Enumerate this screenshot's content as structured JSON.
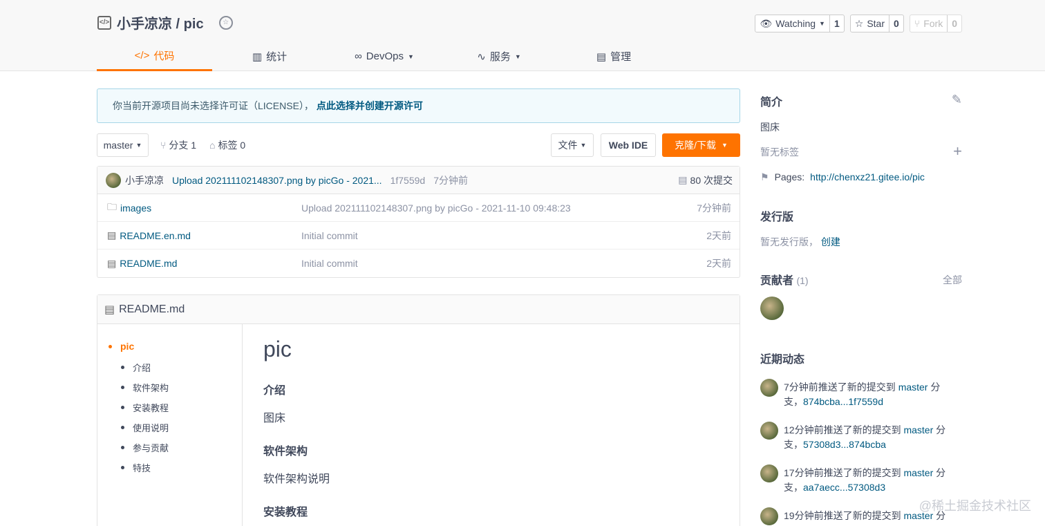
{
  "repo": {
    "title": "小手凉凉 / pic"
  },
  "actions": {
    "watching": {
      "label": "Watching",
      "count": "1"
    },
    "star": {
      "label": "Star",
      "count": "0"
    },
    "fork": {
      "label": "Fork",
      "count": "0"
    }
  },
  "tabs": [
    {
      "label": "代码",
      "icon": "code-icon"
    },
    {
      "label": "统计",
      "icon": "bar-chart-icon"
    },
    {
      "label": "DevOps",
      "icon": "infinity-icon"
    },
    {
      "label": "服务",
      "icon": "pulse-icon"
    },
    {
      "label": "管理",
      "icon": "document-icon"
    }
  ],
  "license": {
    "text": "你当前开源项目尚未选择许可证（LICENSE），",
    "link": "点此选择并创建开源许可"
  },
  "toolbar": {
    "branch": "master",
    "branches": "分支 1",
    "tags": "标签 0",
    "file": "文件",
    "webide": "Web IDE",
    "clone": "克隆/下载"
  },
  "commit": {
    "author": "小手凉凉",
    "message": "Upload 202111102148307.png by picGo - 2021...",
    "sha": "1f7559d",
    "time": "7分钟前",
    "count": "80 次提交"
  },
  "files": [
    {
      "name": "images",
      "type": "folder",
      "message": "Upload 202111102148307.png by picGo - 2021-11-10 09:48:23",
      "time": "7分钟前"
    },
    {
      "name": "README.en.md",
      "type": "file",
      "message": "Initial commit",
      "time": "2天前"
    },
    {
      "name": "README.md",
      "type": "file",
      "message": "Initial commit",
      "time": "2天前"
    }
  ],
  "readme": {
    "filename": "README.md",
    "toc": {
      "top": "pic",
      "items": [
        "介绍",
        "软件架构",
        "安装教程",
        "使用说明",
        "参与贡献",
        "特技"
      ]
    },
    "h1": "pic",
    "intro_heading": "介绍",
    "intro_text": "图床",
    "arch_heading": "软件架构",
    "arch_text": "软件架构说明",
    "install_heading": "安装教程"
  },
  "sidebar": {
    "intro_title": "简介",
    "intro_text": "图床",
    "no_tags": "暂无标签",
    "pages_label": "Pages:",
    "pages_url": "http://chenxz21.gitee.io/pic",
    "release_title": "发行版",
    "no_release": "暂无发行版，",
    "create": "创建",
    "contrib_title": "贡献者",
    "contrib_count": "(1)",
    "all": "全部",
    "activity_title": "近期动态",
    "activities": [
      {
        "prefix": "7分钟前推送了新的提交到 ",
        "branch": "master",
        "suffix": " 分",
        "line2a": "支，",
        "range": "874bcba...1f7559d"
      },
      {
        "prefix": "12分钟前推送了新的提交到 ",
        "branch": "master",
        "suffix": " 分",
        "line2a": "支，",
        "range": "57308d3...874bcba"
      },
      {
        "prefix": "17分钟前推送了新的提交到 ",
        "branch": "master",
        "suffix": " 分",
        "line2a": "支，",
        "range": "aa7aecc...57308d3"
      },
      {
        "prefix": "19分钟前推送了新的提交到 ",
        "branch": "master",
        "suffix": " 分",
        "line2a": "",
        "range": ""
      }
    ]
  },
  "watermark": "@稀土掘金技术社区",
  "colors": {
    "accent": "#fe7300",
    "link": "#005980",
    "text": "#40485b"
  }
}
